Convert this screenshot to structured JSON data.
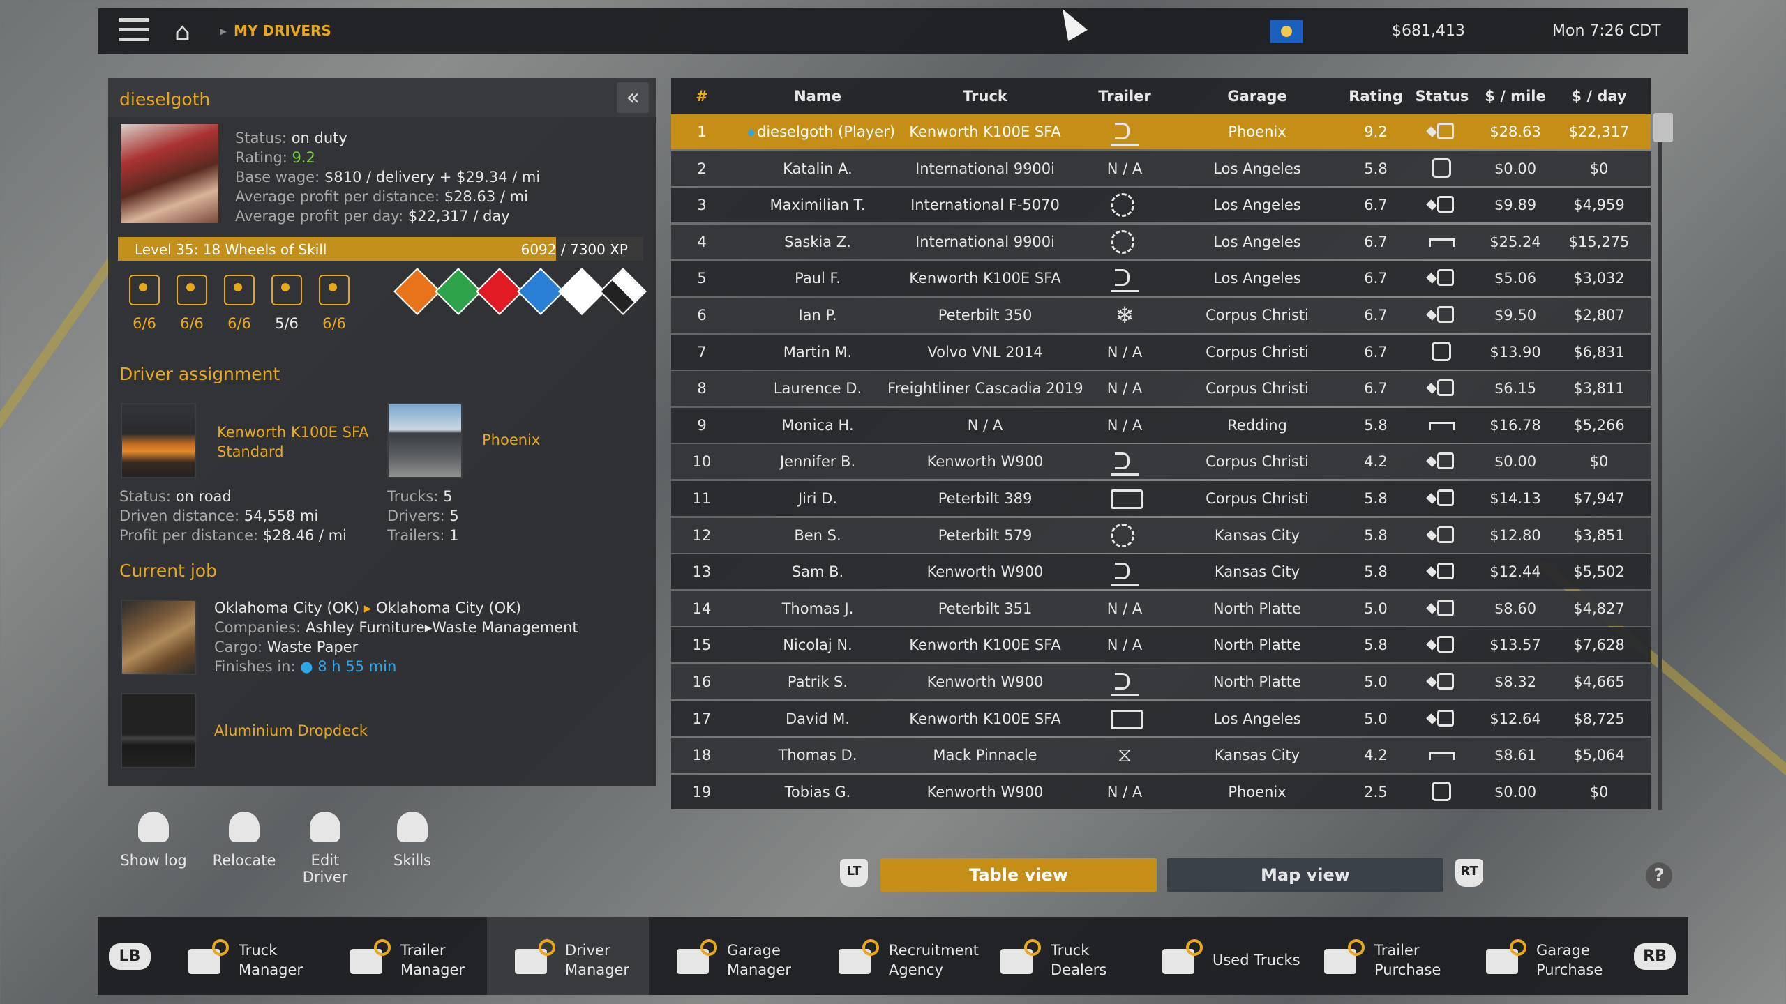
{
  "topbar": {
    "breadcrumb": "MY DRIVERS",
    "money": "$681,413",
    "clock": "Mon 7:26 CDT"
  },
  "driver": {
    "name": "dieselgoth",
    "status_label": "Status:",
    "status": "on duty",
    "rating_label": "Rating:",
    "rating": "9.2",
    "wage_label": "Base wage:",
    "wage": "$810 / delivery + $29.34 / mi",
    "avg_dist_label": "Average profit per distance:",
    "avg_dist": "$28.63 / mi",
    "avg_day_label": "Average profit per day:",
    "avg_day": "$22,317 / day",
    "level": "Level 35: 18 Wheels of Skill",
    "xp_current": "6092",
    "xp_total": " / 7300 XP",
    "xp_fraction": 0.8345,
    "skills": [
      {
        "icon": "long-distance-icon",
        "value": "6/6"
      },
      {
        "icon": "high-value-cargo-icon",
        "value": "6/6"
      },
      {
        "icon": "fragile-cargo-icon",
        "value": "6/6"
      },
      {
        "icon": "just-in-time-icon",
        "value": "5/6"
      },
      {
        "icon": "eco-driving-icon",
        "value": "6/6"
      }
    ],
    "adr": [
      {
        "name": "explosives-adr-icon",
        "color": "#e8731b"
      },
      {
        "name": "gases-adr-icon",
        "color": "#2fa34a"
      },
      {
        "name": "flammable-liquids-adr-icon",
        "color": "#e01b24"
      },
      {
        "name": "flammable-solids-adr-icon",
        "color": "#2a7fd6"
      },
      {
        "name": "toxic-adr-icon",
        "color": "#ffffff"
      },
      {
        "name": "corrosive-adr-icon",
        "color": "#ffffff"
      }
    ]
  },
  "assignment": {
    "title": "Driver assignment",
    "truck_name": "Kenworth  K100E SFA",
    "truck_variant": "Standard",
    "garage": "Phoenix",
    "status_label": "Status:",
    "status": "on road",
    "driven_label": "Driven distance:",
    "driven": "54,558 mi",
    "profit_label": "Profit per distance:",
    "profit": "$28.46 / mi",
    "trucks_label": "Trucks:",
    "trucks": "5",
    "drivers_label": "Drivers:",
    "drivers": "5",
    "trailers_label": "Trailers:",
    "trailers": "1"
  },
  "job": {
    "title": "Current job",
    "from": "Oklahoma City (OK)",
    "to": "Oklahoma City (OK)",
    "companies_label": "Companies:",
    "company_from": "Ashley Furniture",
    "company_to": "Waste Management",
    "cargo_label": "Cargo:",
    "cargo": "Waste Paper",
    "finishes_label": "Finishes in:",
    "finishes": "8 h 55 min",
    "trailer": "Aluminium Dropdeck"
  },
  "actions": [
    "Show log",
    "Relocate",
    "Edit Driver",
    "Skills"
  ],
  "table": {
    "headers": {
      "num": "#",
      "name": "Name",
      "truck": "Truck",
      "trailer": "Trailer",
      "garage": "Garage",
      "rating": "Rating",
      "status": "Status",
      "mile": "$ / mile",
      "day": "$ / day"
    },
    "rows": [
      {
        "n": "1",
        "name": "dieselgoth (Player)",
        "truck": "Kenworth  K100E SFA",
        "trailer": "trailer-icon",
        "garage": "Phoenix",
        "rating": "9.2",
        "status": "driving-icon",
        "mile": "$28.63",
        "day": "$22,317"
      },
      {
        "n": "2",
        "name": "Katalin A.",
        "truck": "International 9900i",
        "trailer": "N / A",
        "garage": "Los Angeles",
        "rating": "5.8",
        "status": "idle-icon",
        "mile": "$0.00",
        "day": "$0"
      },
      {
        "n": "3",
        "name": "Maximilian T.",
        "truck": "International F-5070",
        "trailer": "gear-trailer-icon",
        "garage": "Los Angeles",
        "rating": "6.7",
        "status": "driving-icon",
        "mile": "$9.89",
        "day": "$4,959"
      },
      {
        "n": "4",
        "name": "Saskia Z.",
        "truck": "International 9900i",
        "trailer": "gear-trailer-icon",
        "garage": "Los Angeles",
        "rating": "6.7",
        "status": "resting-icon",
        "mile": "$25.24",
        "day": "$15,275"
      },
      {
        "n": "5",
        "name": "Paul F.",
        "truck": "Kenworth  K100E SFA",
        "trailer": "trailer-icon",
        "garage": "Los Angeles",
        "rating": "6.7",
        "status": "driving-icon",
        "mile": "$5.06",
        "day": "$3,032"
      },
      {
        "n": "6",
        "name": "Ian P.",
        "truck": "Peterbilt 350",
        "trailer": "reefer-trailer-icon",
        "garage": "Corpus Christi",
        "rating": "6.7",
        "status": "driving-icon",
        "mile": "$9.50",
        "day": "$2,807"
      },
      {
        "n": "7",
        "name": "Martin M.",
        "truck": "Volvo VNL 2014",
        "trailer": "N / A",
        "garage": "Corpus Christi",
        "rating": "6.7",
        "status": "idle-icon",
        "mile": "$13.90",
        "day": "$6,831"
      },
      {
        "n": "8",
        "name": "Laurence D.",
        "truck": "Freightliner Cascadia 2019",
        "trailer": "N / A",
        "garage": "Corpus Christi",
        "rating": "6.7",
        "status": "driving-icon",
        "mile": "$6.15",
        "day": "$3,811"
      },
      {
        "n": "9",
        "name": "Monica H.",
        "truck": "N / A",
        "trailer": "N / A",
        "garage": "Redding",
        "rating": "5.8",
        "status": "resting-icon",
        "mile": "$16.78",
        "day": "$5,266"
      },
      {
        "n": "10",
        "name": "Jennifer B.",
        "truck": "Kenworth W900",
        "trailer": "trailer-icon",
        "garage": "Corpus Christi",
        "rating": "4.2",
        "status": "driving-icon",
        "mile": "$0.00",
        "day": "$0"
      },
      {
        "n": "11",
        "name": "Jiri D.",
        "truck": "Peterbilt 389",
        "trailer": "box-trailer-icon",
        "garage": "Corpus Christi",
        "rating": "5.8",
        "status": "driving-icon",
        "mile": "$14.13",
        "day": "$7,947"
      },
      {
        "n": "12",
        "name": "Ben S.",
        "truck": "Peterbilt 579",
        "trailer": "gear-trailer-icon",
        "garage": "Kansas City",
        "rating": "5.8",
        "status": "driving-icon",
        "mile": "$12.80",
        "day": "$3,851"
      },
      {
        "n": "13",
        "name": "Sam B.",
        "truck": "Kenworth W900",
        "trailer": "trailer-icon",
        "garage": "Kansas City",
        "rating": "5.8",
        "status": "driving-icon",
        "mile": "$12.44",
        "day": "$5,502"
      },
      {
        "n": "14",
        "name": "Thomas J.",
        "truck": "Peterbilt 351",
        "trailer": "N / A",
        "garage": "North Platte",
        "rating": "5.0",
        "status": "driving-icon",
        "mile": "$8.60",
        "day": "$4,827"
      },
      {
        "n": "15",
        "name": "Nicolaj N.",
        "truck": "Kenworth  K100E SFA",
        "trailer": "N / A",
        "garage": "North Platte",
        "rating": "5.8",
        "status": "driving-icon",
        "mile": "$13.57",
        "day": "$7,628"
      },
      {
        "n": "16",
        "name": "Patrik S.",
        "truck": "Kenworth W900",
        "trailer": "trailer-icon",
        "garage": "North Platte",
        "rating": "5.0",
        "status": "driving-icon",
        "mile": "$8.32",
        "day": "$4,665"
      },
      {
        "n": "17",
        "name": "David M.",
        "truck": "Kenworth  K100E SFA",
        "trailer": "box-trailer-icon",
        "garage": "Los Angeles",
        "rating": "5.0",
        "status": "driving-icon",
        "mile": "$12.64",
        "day": "$8,725"
      },
      {
        "n": "18",
        "name": "Thomas D.",
        "truck": "Mack Pinnacle",
        "trailer": "tipper-trailer-icon",
        "garage": "Kansas City",
        "rating": "4.2",
        "status": "resting-icon",
        "mile": "$8.61",
        "day": "$5,064"
      },
      {
        "n": "19",
        "name": "Tobias G.",
        "truck": "Kenworth W900",
        "trailer": "N / A",
        "garage": "Phoenix",
        "rating": "2.5",
        "status": "idle-icon",
        "mile": "$0.00",
        "day": "$0"
      }
    ]
  },
  "views": {
    "lt": "LT",
    "table": "Table view",
    "map": "Map view",
    "rt": "RT",
    "help": "?"
  },
  "bottom": {
    "lb": "LB",
    "rb": "RB",
    "items": [
      {
        "label": "Truck\nManager"
      },
      {
        "label": "Trailer\nManager"
      },
      {
        "label": "Driver\nManager"
      },
      {
        "label": "Garage\nManager"
      },
      {
        "label": "Recruitment\nAgency"
      },
      {
        "label": "Truck\nDealers"
      },
      {
        "label": "Used Trucks"
      },
      {
        "label": "Trailer\nPurchase"
      },
      {
        "label": "Garage\nPurchase"
      }
    ]
  }
}
